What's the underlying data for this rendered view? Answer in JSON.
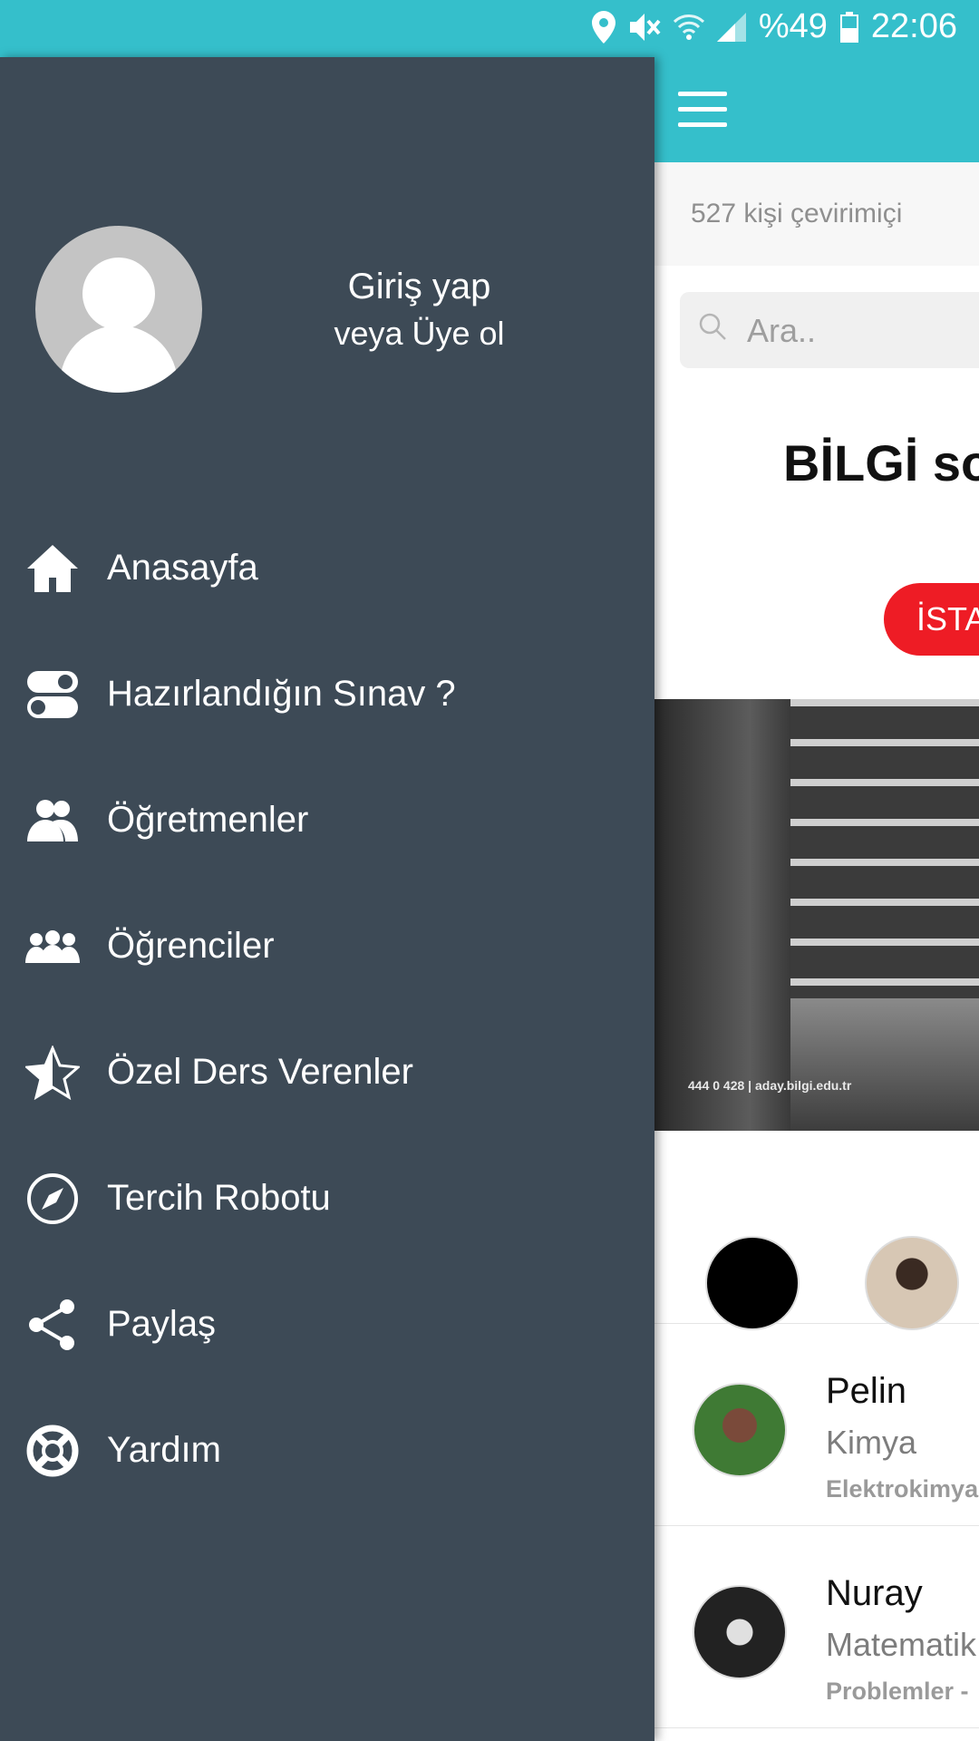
{
  "status_bar": {
    "battery": "%49",
    "time": "22:06",
    "icons": [
      "location-icon",
      "mute-icon",
      "wifi-icon",
      "signal-icon",
      "battery-icon"
    ]
  },
  "drawer": {
    "login_title": "Giriş yap",
    "login_subtitle": "veya Üye ol",
    "menu": [
      {
        "label": "Anasayfa",
        "icon": "home-icon"
      },
      {
        "label": "Hazırlandığın Sınav ?",
        "icon": "toggle-icon"
      },
      {
        "label": "Öğretmenler",
        "icon": "teachers-icon"
      },
      {
        "label": "Öğrenciler",
        "icon": "students-icon"
      },
      {
        "label": "Özel Ders Verenler",
        "icon": "star-icon"
      },
      {
        "label": "Tercih Robotu",
        "icon": "compass-icon"
      },
      {
        "label": "Paylaş",
        "icon": "share-icon"
      },
      {
        "label": "Yardım",
        "icon": "help-lifebuoy-icon"
      }
    ]
  },
  "content": {
    "online_count": "527 kişi çevirimiçi",
    "search_placeholder": "Ara..",
    "headline": "BİLGİ so",
    "pill_button": "İSTA",
    "banner_caption": "444 0 428 | aday.bilgi.edu.tr",
    "list": [
      {
        "name": "Pelin",
        "subject": "Kimya",
        "topic": "Elektrokimya"
      },
      {
        "name": "Nuray",
        "subject": "Matematik",
        "topic": "Problemler - "
      }
    ]
  },
  "colors": {
    "accent": "#35bfcb",
    "drawer_bg": "#3d4a56",
    "pill_red": "#ee1c25"
  }
}
